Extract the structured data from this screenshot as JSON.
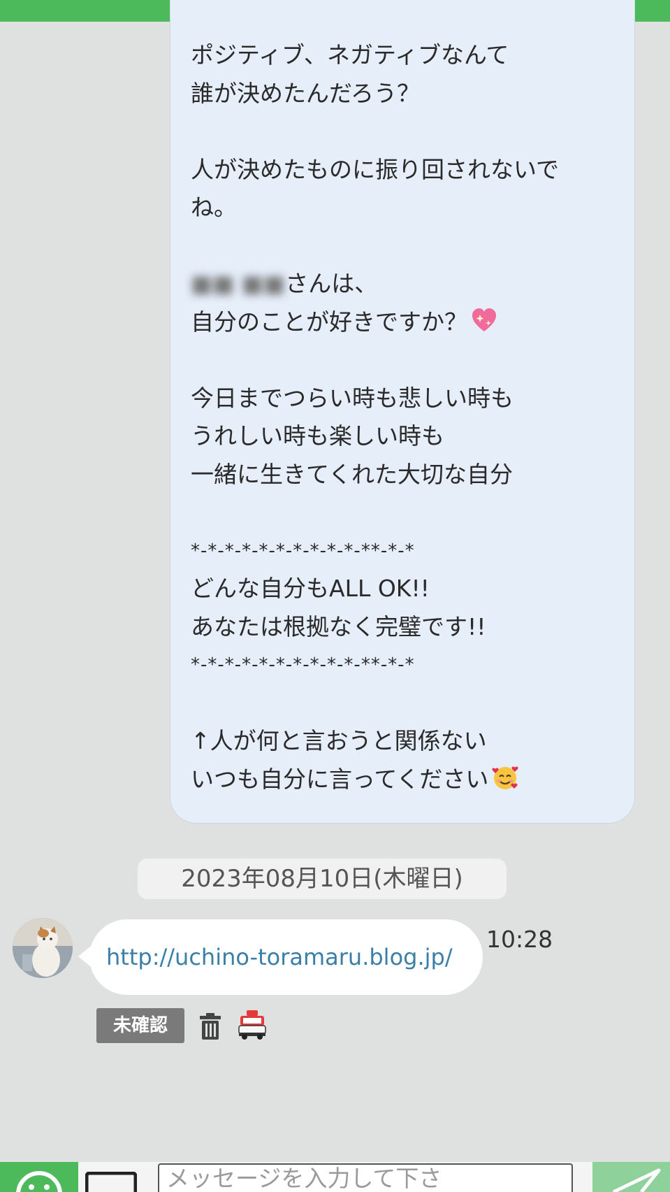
{
  "colors": {
    "header_green": "#4cb95b",
    "outgoing_bubble": "#e6eefa",
    "link": "#3a7fa8",
    "background": "#dfe1e1"
  },
  "outgoing_message": {
    "lines": [
      "ポジティブ、ネガティブなんて",
      "誰が決めたんだろう？",
      "",
      "人が決めたものに振り回されないで",
      "ね。",
      "",
      "さんは、",
      "自分のことが好きですか？",
      "",
      "今日までつらい時も悲しい時も",
      "うれしい時も楽しい時も",
      "一緒に生きてくれた大切な自分",
      "",
      "*-*-*-*-*-*-*-*-*-*-**-*-*",
      "どんな自分もALL OK!!",
      "あなたは根拠なく完璧です!!",
      "*-*-*-*-*-*-*-*-*-*-**-*-*",
      "",
      "↑人が何と言おうと関係ない",
      "いつも自分に言ってください"
    ],
    "blurred_name": "■■ ■■",
    "heart_emoji_icon": "sparkling-heart-icon",
    "smile_emoji_icon": "smiling-face-with-hearts-icon"
  },
  "date_separator": "2023年08月10日(木曜日)",
  "incoming_message": {
    "link_text": "http://uchino-toramaru.blog.jp/",
    "time": "10:28",
    "avatar_icon": "cat-avatar"
  },
  "status": {
    "unread_label": "未確認",
    "trash_icon": "trash-icon",
    "report_icon": "report-police-icon"
  },
  "input_bar": {
    "placeholder": "メッセージを入力して下さ",
    "emoji_icon": "emoji-smile-icon",
    "image_icon": "image-icon",
    "send_icon": "send-arrow-icon"
  }
}
